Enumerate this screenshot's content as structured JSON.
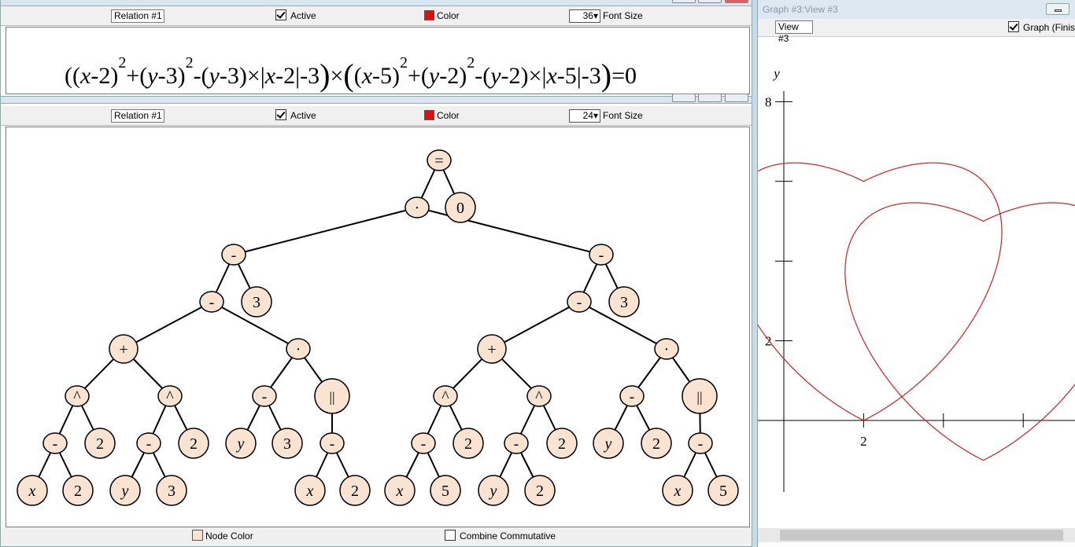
{
  "top_window": {
    "relation_label": "Relation #1",
    "active_label": "Active",
    "active_checked": true,
    "color_label": "Color",
    "color_value": "#e01010",
    "font_size_value": "36",
    "font_size_label": "Font Size"
  },
  "equation": {
    "segments": [
      {
        "t": "("
      },
      {
        "t": "(",
        "s": "sm"
      },
      {
        "t": "x",
        "i": true
      },
      {
        "t": "-2"
      },
      {
        "t": ")",
        "s": "sm"
      },
      {
        "t": "2",
        "sup": true
      },
      {
        "t": "+"
      },
      {
        "t": "("
      },
      {
        "t": "y",
        "i": true
      },
      {
        "t": "-3)"
      },
      {
        "t": "2",
        "sup": true
      },
      {
        "t": "-("
      },
      {
        "t": "y",
        "i": true
      },
      {
        "t": "-3)×|"
      },
      {
        "t": "x",
        "i": true
      },
      {
        "t": "-2|-3"
      },
      {
        "t": ")",
        "s": "big"
      },
      {
        "t": "×"
      },
      {
        "t": "(",
        "s": "big"
      },
      {
        "t": "("
      },
      {
        "t": "x",
        "i": true
      },
      {
        "t": "-5)"
      },
      {
        "t": "2",
        "sup": true
      },
      {
        "t": "+("
      },
      {
        "t": "y",
        "i": true
      },
      {
        "t": "-2)"
      },
      {
        "t": "2",
        "sup": true
      },
      {
        "t": "-("
      },
      {
        "t": "y",
        "i": true
      },
      {
        "t": "-2)×|"
      },
      {
        "t": "x",
        "i": true
      },
      {
        "t": "-5|-3"
      },
      {
        "t": ")",
        "s": "big"
      },
      {
        "t": "=0"
      }
    ]
  },
  "tree_window": {
    "relation_label": "Relation #1",
    "active_label": "Active",
    "active_checked": true,
    "color_label": "Color",
    "color_value": "#e01010",
    "font_size_value": "24",
    "font_size_label": "Font Size",
    "node_color_label": "Node Color",
    "node_color_value": "#fbe3d2",
    "combine_label": "Combine Commutative",
    "combine_checked": false
  },
  "expression_tree": {
    "nodes": [
      {
        "id": "eq",
        "label": "="
      },
      {
        "id": "mul",
        "label": "·",
        "parent": "eq"
      },
      {
        "id": "zero",
        "label": "0",
        "parent": "eq"
      },
      {
        "id": "L1",
        "label": "-",
        "parent": "mul"
      },
      {
        "id": "R1",
        "label": "-",
        "parent": "mul"
      },
      {
        "id": "L2",
        "label": "-",
        "parent": "L1"
      },
      {
        "id": "L3",
        "label": "3",
        "parent": "L1"
      },
      {
        "id": "L4",
        "label": "+",
        "parent": "L2"
      },
      {
        "id": "L5",
        "label": "·",
        "parent": "L2"
      },
      {
        "id": "L6",
        "label": "^",
        "parent": "L4"
      },
      {
        "id": "L7",
        "label": "^",
        "parent": "L4"
      },
      {
        "id": "L8",
        "label": "-",
        "parent": "L5"
      },
      {
        "id": "L9",
        "label": "||",
        "parent": "L5"
      },
      {
        "id": "L10",
        "label": "-",
        "parent": "L6"
      },
      {
        "id": "L11",
        "label": "2",
        "parent": "L6"
      },
      {
        "id": "L12",
        "label": "-",
        "parent": "L7"
      },
      {
        "id": "L13",
        "label": "2",
        "parent": "L7"
      },
      {
        "id": "L14",
        "label": "y",
        "parent": "L8",
        "italic": true
      },
      {
        "id": "L15",
        "label": "3",
        "parent": "L8"
      },
      {
        "id": "L16",
        "label": "-",
        "parent": "L9"
      },
      {
        "id": "L17",
        "label": "x",
        "parent": "L10",
        "italic": true
      },
      {
        "id": "L18",
        "label": "2",
        "parent": "L10"
      },
      {
        "id": "L19",
        "label": "y",
        "parent": "L12",
        "italic": true
      },
      {
        "id": "L20",
        "label": "3",
        "parent": "L12"
      },
      {
        "id": "L21",
        "label": "x",
        "parent": "L16",
        "italic": true
      },
      {
        "id": "L22",
        "label": "2",
        "parent": "L16"
      },
      {
        "id": "R2",
        "label": "-",
        "parent": "R1"
      },
      {
        "id": "R3",
        "label": "3",
        "parent": "R1"
      },
      {
        "id": "R4",
        "label": "+",
        "parent": "R2"
      },
      {
        "id": "R5",
        "label": "·",
        "parent": "R2"
      },
      {
        "id": "R6",
        "label": "^",
        "parent": "R4"
      },
      {
        "id": "R7",
        "label": "^",
        "parent": "R4"
      },
      {
        "id": "R8",
        "label": "-",
        "parent": "R5"
      },
      {
        "id": "R9",
        "label": "||",
        "parent": "R5"
      },
      {
        "id": "R10",
        "label": "-",
        "parent": "R6"
      },
      {
        "id": "R11",
        "label": "2",
        "parent": "R6"
      },
      {
        "id": "R12",
        "label": "-",
        "parent": "R7"
      },
      {
        "id": "R13",
        "label": "2",
        "parent": "R7"
      },
      {
        "id": "R14",
        "label": "y",
        "parent": "R8",
        "italic": true
      },
      {
        "id": "R15",
        "label": "2",
        "parent": "R8"
      },
      {
        "id": "R16",
        "label": "-",
        "parent": "R9"
      },
      {
        "id": "R17",
        "label": "x",
        "parent": "R10",
        "italic": true
      },
      {
        "id": "R18",
        "label": "5",
        "parent": "R10"
      },
      {
        "id": "R19",
        "label": "y",
        "parent": "R12",
        "italic": true
      },
      {
        "id": "R20",
        "label": "2",
        "parent": "R12"
      },
      {
        "id": "R21",
        "label": "x",
        "parent": "R16",
        "italic": true
      },
      {
        "id": "R22",
        "label": "5",
        "parent": "R16"
      }
    ]
  },
  "graph_window": {
    "title": "Graph #3:View #3",
    "view_label": "View #3",
    "graph_checkbox_label": "Graph (Finis",
    "graph_checked": true,
    "y_axis_label": "y",
    "y_tick_labels": [
      "8",
      "2"
    ],
    "x_tick_labels": [
      "2"
    ],
    "curve_color": "#cc2020"
  }
}
